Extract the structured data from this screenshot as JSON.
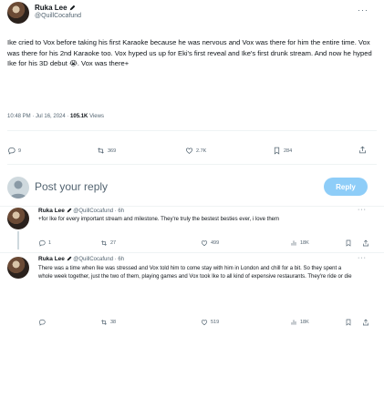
{
  "main_tweet": {
    "author_name": "Ruka Lee",
    "author_handle": "@QuillCocafund",
    "text": "Ike cried to Vox before taking his first Karaoke because he was nervous and Vox was there for him the entire time. Vox was there for his 2nd Karaoke too. Vox hyped us up for Eki's first reveal and Ike's first drunk stream. And now he hyped Ike for his 3D debut 😭. Vox was there+",
    "time": "10:48 PM · Jul 16, 2024 · ",
    "views_count": "105.1K",
    "views_label": " Views",
    "stats": {
      "replies": "9",
      "retweets": "369",
      "likes": "2.7K",
      "bookmarks": "284"
    }
  },
  "composer": {
    "placeholder": "Post your reply",
    "reply_button": "Reply"
  },
  "replies": [
    {
      "author_name": "Ruka Lee",
      "author_handle": "@QuillCocafund",
      "time": "· 6h",
      "text": "+for Ike for every important stream and milestone. They're truly the bestest besties ever, i love them",
      "stats": {
        "replies": "1",
        "retweets": "27",
        "likes": "499",
        "views": "18K"
      }
    },
    {
      "author_name": "Ruka Lee",
      "author_handle": "@QuillCocafund",
      "time": "· 6h",
      "text": "There was a time when Ike was stressed and Vox told him to come stay with him in London and chill for a bit. So they spent a whole week together, just the two of them, playing games and Vox took Ike to all kind of expensive restaurants. They're ride or die",
      "stats": {
        "replies": "",
        "retweets": "38",
        "likes": "519",
        "views": "18K"
      }
    }
  ],
  "more_label": "···",
  "colors": {
    "accent": "#1d9bf0",
    "reply_disabled": "#8ecdf8",
    "muted": "#536471",
    "divider": "#eff3f4"
  }
}
